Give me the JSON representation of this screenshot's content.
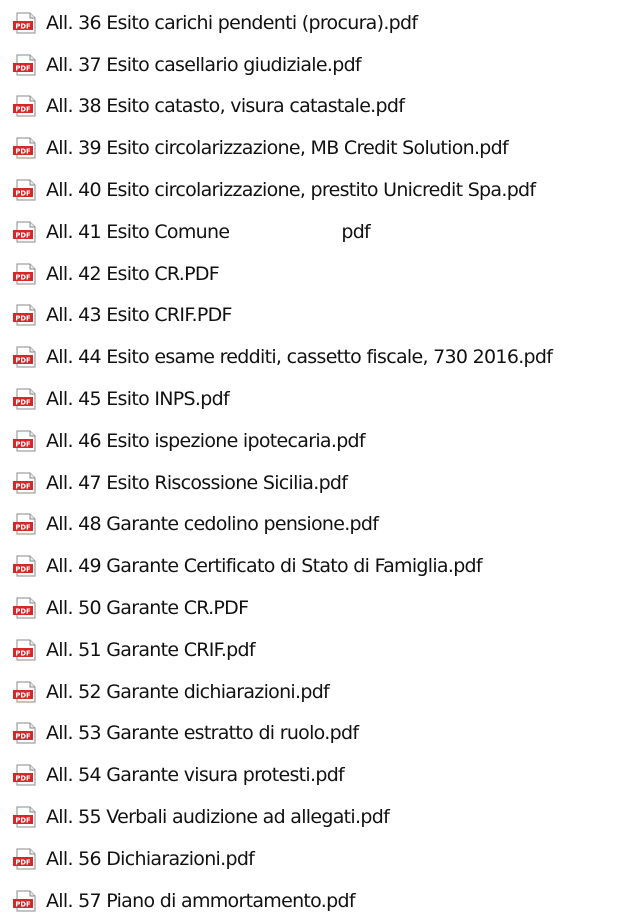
{
  "file_list": {
    "icon": "pdf-file-icon",
    "icon_label": "PDF",
    "accent_color": "#d62828",
    "items": [
      {
        "name": "All. 36 Esito carichi pendenti (procura).pdf"
      },
      {
        "name": "All. 37 Esito casellario giudiziale.pdf"
      },
      {
        "name": "All. 38 Esito catasto, visura catastale.pdf"
      },
      {
        "name": "All. 39 Esito circolarizzazione, MB Credit Solution.pdf"
      },
      {
        "name": "All. 40 Esito circolarizzazione, prestito Unicredit Spa.pdf"
      },
      {
        "name": "All. 41 Esito Comune",
        "suffix": "pdf"
      },
      {
        "name": "All. 42 Esito CR.PDF"
      },
      {
        "name": "All. 43 Esito CRIF.PDF"
      },
      {
        "name": "All. 44 Esito esame redditi, cassetto fiscale, 730 2016.pdf"
      },
      {
        "name": "All. 45 Esito INPS.pdf"
      },
      {
        "name": "All. 46 Esito ispezione ipotecaria.pdf"
      },
      {
        "name": "All. 47 Esito Riscossione Sicilia.pdf"
      },
      {
        "name": "All. 48 Garante cedolino pensione.pdf"
      },
      {
        "name": "All. 49 Garante Certificato di Stato di Famiglia.pdf"
      },
      {
        "name": "All. 50 Garante CR.PDF"
      },
      {
        "name": "All. 51 Garante CRIF.pdf"
      },
      {
        "name": "All. 52 Garante dichiarazioni.pdf"
      },
      {
        "name": "All. 53 Garante estratto di ruolo.pdf"
      },
      {
        "name": "All. 54 Garante visura protesti.pdf"
      },
      {
        "name": "All. 55 Verbali audizione ad allegati.pdf"
      },
      {
        "name": "All. 56 Dichiarazioni.pdf"
      },
      {
        "name": "All. 57 Piano di ammortamento.pdf"
      }
    ]
  }
}
